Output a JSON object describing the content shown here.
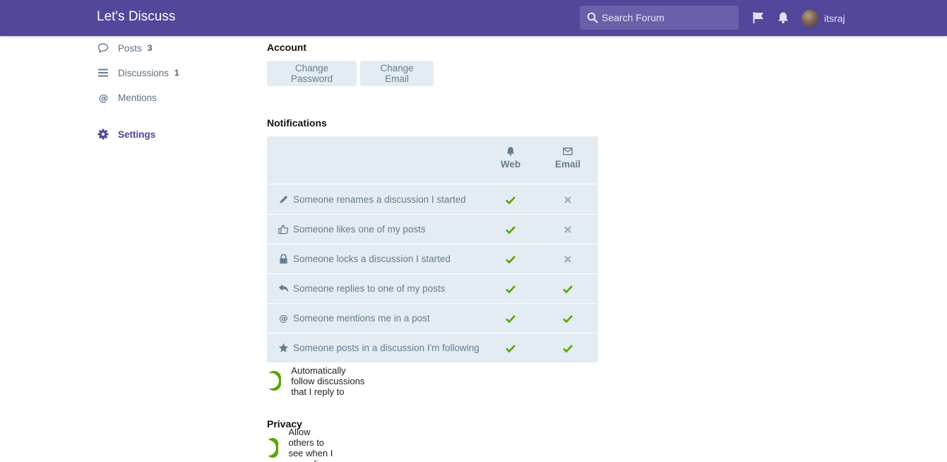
{
  "header": {
    "brand": "Let's Discuss",
    "search_placeholder": "Search Forum",
    "username": "itsraj",
    "accent": "#52479a"
  },
  "sidebar": {
    "items": [
      {
        "label": "Posts",
        "count": "3",
        "icon": "comment-icon"
      },
      {
        "label": "Discussions",
        "count": "1",
        "icon": "list-icon"
      },
      {
        "label": "Mentions",
        "count": "",
        "icon": "at-icon"
      },
      {
        "label": "Settings",
        "count": "",
        "icon": "gear-icon",
        "active": true
      }
    ]
  },
  "account": {
    "title": "Account",
    "change_password": "Change Password",
    "change_email": "Change Email"
  },
  "notifications": {
    "title": "Notifications",
    "columns": [
      "Web",
      "Email"
    ],
    "rows": [
      {
        "label": "Someone renames a discussion I started",
        "icon": "pencil-icon",
        "web": true,
        "email": false
      },
      {
        "label": "Someone likes one of my posts",
        "icon": "thumbs-up-icon",
        "web": true,
        "email": false
      },
      {
        "label": "Someone locks a discussion I started",
        "icon": "lock-icon",
        "web": true,
        "email": false
      },
      {
        "label": "Someone replies to one of my posts",
        "icon": "reply-icon",
        "web": true,
        "email": true
      },
      {
        "label": "Someone mentions me in a post",
        "icon": "at-icon",
        "web": true,
        "email": true
      },
      {
        "label": "Someone posts in a discussion I'm following",
        "icon": "star-icon",
        "web": true,
        "email": true
      }
    ],
    "auto_follow_label": "Automatically follow discussions that I reply to",
    "auto_follow_on": true
  },
  "privacy": {
    "title": "Privacy",
    "online_label": "Allow others to see when I am online",
    "online_on": true
  },
  "colors": {
    "check": "#58a400",
    "cross": "#a3aeb8",
    "panel": "#e3ecf2",
    "muted_text": "#667d8f"
  }
}
